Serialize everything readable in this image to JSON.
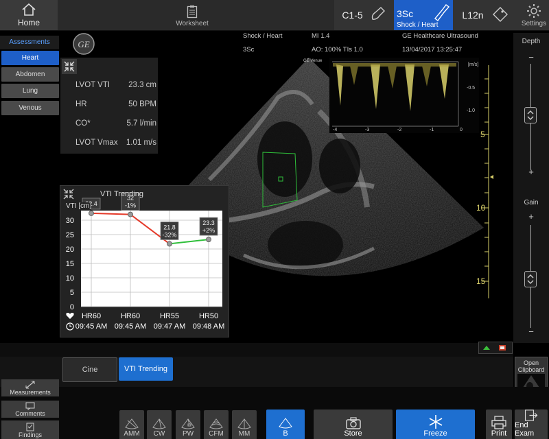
{
  "topbar": {
    "home_label": "Home",
    "worksheet_label": "Worksheet",
    "probes": [
      {
        "name": "C1-5"
      },
      {
        "name": "3Sc",
        "preset": "Shock / Heart"
      },
      {
        "name": "L12n"
      }
    ],
    "settings_label": "Settings"
  },
  "assessments": {
    "title": "Assessments",
    "items": [
      "Heart",
      "Abdomen",
      "Lung",
      "Venous"
    ],
    "selected": "Heart"
  },
  "image_info": {
    "preset": "Shock / Heart",
    "probe": "3Sc",
    "mi": "MI 1.4",
    "ao_tis": "AO: 100% TIs 1.0",
    "company": "GE Healthcare Ultrasound",
    "datetime": "13/04/2017 13:25:47",
    "venue_tag": "GE Venue"
  },
  "measurements": [
    {
      "label": "LVOT VTI",
      "value": "23.3 cm"
    },
    {
      "label": "HR",
      "value": "50 BPM"
    },
    {
      "label": "CO*",
      "value": "5.7 l/min"
    },
    {
      "label": "LVOT Vmax",
      "value": "1.01 m/s"
    }
  ],
  "spectral": {
    "unit": "[m/s]",
    "y_ticks": [
      "-0.5",
      "-1.0"
    ],
    "x_ticks": [
      "-4",
      "-3",
      "-2",
      "-1",
      "0"
    ]
  },
  "depth_ruler": {
    "ticks": [
      "5",
      "10",
      "15"
    ]
  },
  "right_panel": {
    "depth_label": "Depth",
    "gain_label": "Gain",
    "plus": "+",
    "minus": "−"
  },
  "trending": {
    "title": "VTI Trending",
    "ylabel": "VTI [cm]",
    "ylim": [
      0,
      30
    ],
    "y_ticks": [
      "0",
      "5",
      "10",
      "15",
      "20",
      "25",
      "30"
    ],
    "points": [
      {
        "hr": "HR60",
        "time": "09:45 AM",
        "value": 32.4,
        "label": "32.4",
        "change": ""
      },
      {
        "hr": "HR60",
        "time": "09:45 AM",
        "value": 32,
        "label": "32",
        "change": "-1%"
      },
      {
        "hr": "HR55",
        "time": "09:47 AM",
        "value": 21.8,
        "label": "21.8",
        "change": "-32%"
      },
      {
        "hr": "HR50",
        "time": "09:48 AM",
        "value": 23.3,
        "label": "23.3",
        "change": "+2%"
      }
    ],
    "colors": {
      "decrease": "#e53a2a",
      "increase": "#2fbf3a"
    }
  },
  "chart_data": {
    "type": "line",
    "title": "VTI Trending",
    "ylabel": "VTI [cm]",
    "ylim": [
      0,
      30
    ],
    "categories": [
      "HR60 09:45 AM",
      "HR60 09:45 AM",
      "HR55 09:47 AM",
      "HR50 09:48 AM"
    ],
    "values": [
      32.4,
      32,
      21.8,
      23.3
    ],
    "annotations": [
      "32.4",
      "32 -1%",
      "21.8 -32%",
      "23.3 +2%"
    ]
  },
  "tabs": [
    {
      "label": "Cine"
    },
    {
      "label": "VTI Trending",
      "active": true
    }
  ],
  "clipboard": {
    "label_line1": "Open",
    "label_line2": "Clipboard"
  },
  "side_buttons": [
    "Measurements",
    "Comments",
    "Findings"
  ],
  "mode_buttons": [
    "AMM",
    "CW",
    "PW",
    "CFM",
    "MM"
  ],
  "actions": {
    "b_label": "B",
    "store_label": "Store",
    "freeze_label": "Freeze",
    "print_label": "Print",
    "end_exam_label": "End Exam"
  }
}
